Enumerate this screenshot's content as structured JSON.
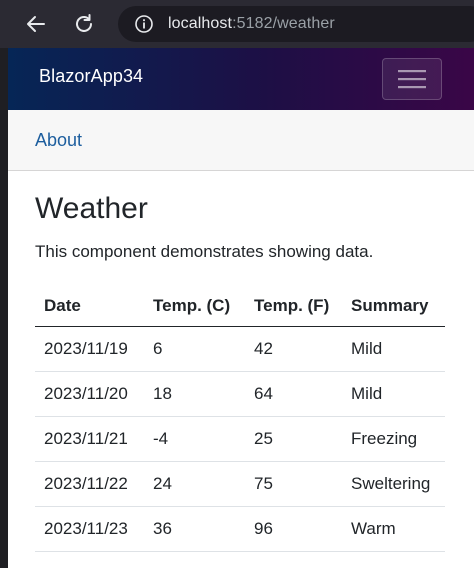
{
  "browser": {
    "url_host": "localhost",
    "url_rest": ":5182/weather"
  },
  "app": {
    "brand": "BlazorApp34",
    "nav_link": "About"
  },
  "page": {
    "title": "Weather",
    "description": "This component demonstrates showing data."
  },
  "table": {
    "headers": [
      "Date",
      "Temp. (C)",
      "Temp. (F)",
      "Summary"
    ],
    "rows": [
      [
        "2023/11/19",
        "6",
        "42",
        "Mild"
      ],
      [
        "2023/11/20",
        "18",
        "64",
        "Mild"
      ],
      [
        "2023/11/21",
        "-4",
        "25",
        "Freezing"
      ],
      [
        "2023/11/22",
        "24",
        "75",
        "Sweltering"
      ],
      [
        "2023/11/23",
        "36",
        "96",
        "Warm"
      ]
    ]
  },
  "colors": {
    "navbar_gradient_start": "#062656",
    "navbar_gradient_end": "#3a0647",
    "link": "#1d5e9e"
  }
}
